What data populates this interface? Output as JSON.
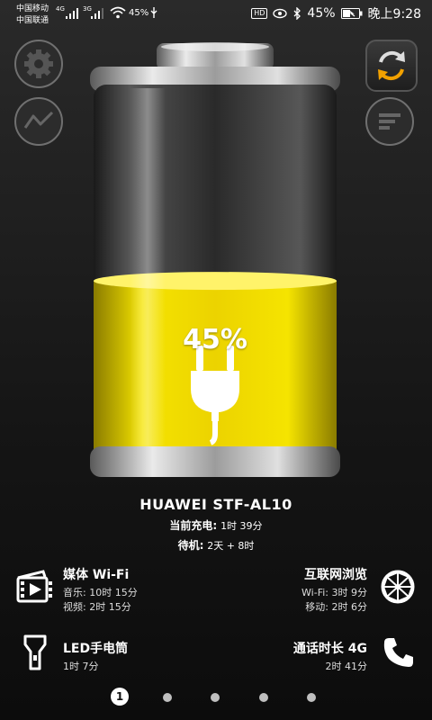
{
  "status_bar": {
    "carrier_1": "中国移动",
    "carrier_1_net": "4G",
    "carrier_2": "中国联通",
    "carrier_2_net": "3G",
    "hd_badge": "HD",
    "battery_text": "45%",
    "time": "晚上9:28"
  },
  "battery": {
    "percent_label": "45%",
    "level": 0.45,
    "fill_color": "#ecd300",
    "state_icon": "plug-icon"
  },
  "top_buttons": {
    "left_top": "gear-icon",
    "left_bottom": "graph-icon",
    "right_top": "refresh-icon",
    "right_bottom": "list-icon"
  },
  "device": {
    "name": "HUAWEI STF-AL10",
    "charging_label": "当前充电:",
    "charging_value": "1时 39分",
    "standby_label": "待机:",
    "standby_value": "2天 + 8时"
  },
  "stats": {
    "media": {
      "title": "媒体 Wi-Fi",
      "line1": "音乐: 10时 15分",
      "line2": "视频: 2时 15分",
      "icon": "video-icon"
    },
    "internet": {
      "title": "互联网浏览",
      "line1": "Wi-Fi: 3时 9分",
      "line2": "移动: 2时 6分",
      "icon": "globe-icon"
    },
    "flashlight": {
      "title": "LED手电筒",
      "line1": "1时 7分",
      "icon": "flashlight-icon"
    },
    "call": {
      "title": "通话时长 4G",
      "line1": "2时 41分",
      "icon": "phone-icon"
    }
  },
  "pager": {
    "active_label": "1",
    "total_pages": 5
  }
}
